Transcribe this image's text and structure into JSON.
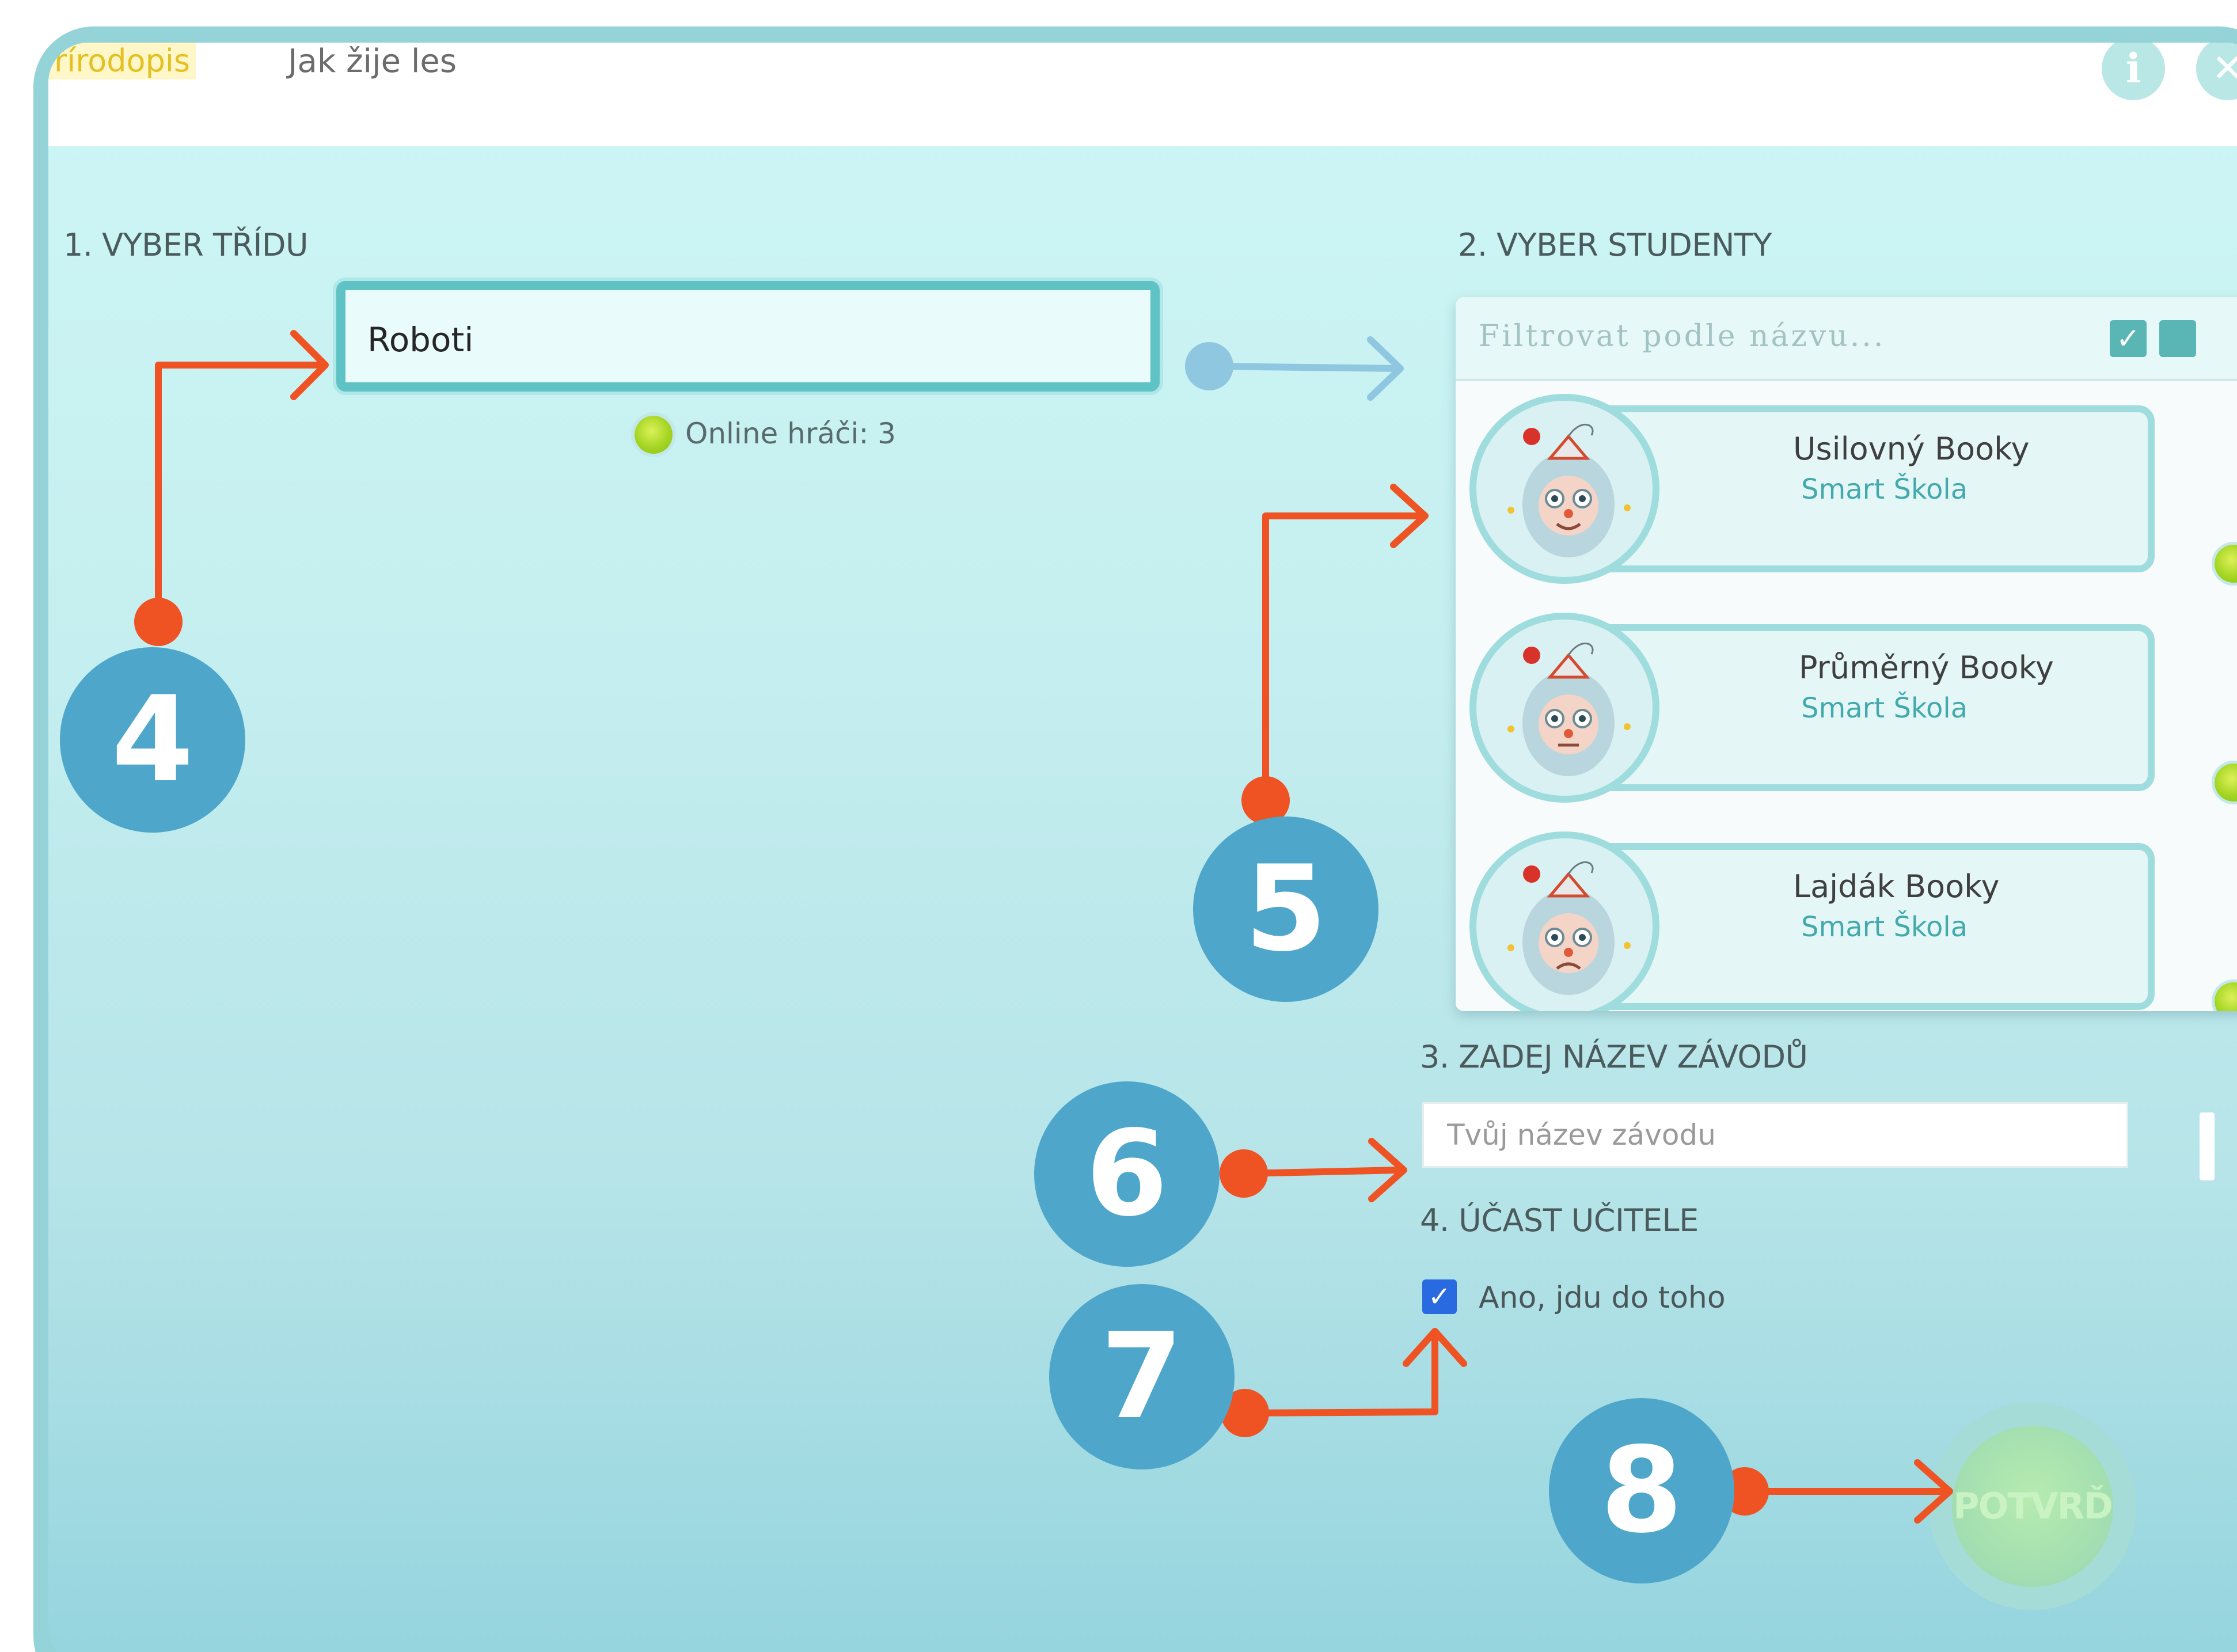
{
  "header": {
    "subject": "řírodopis",
    "title": "Jak žije les",
    "info_icon": "info-icon",
    "close_icon": "close-icon",
    "info_glyph": "i",
    "close_glyph": "✕"
  },
  "step1": {
    "label": "1. VYBER TŘÍDU",
    "selected_class": "Roboti",
    "online_text": "Online hráči: 3"
  },
  "step2": {
    "label": "2. VYBER STUDENTY",
    "filter_placeholder": "Filtrovat podle názvu...",
    "students": [
      {
        "name": "Usilovný Booky",
        "school": "Smart Škola",
        "status": "online"
      },
      {
        "name": "Průměrný Booky",
        "school": "Smart Škola",
        "status": "online"
      },
      {
        "name": "Lajdák Booky",
        "school": "Smart Škola",
        "status": "online"
      }
    ]
  },
  "step3": {
    "label": "3. ZADEJ NÁZEV ZÁVODŮ",
    "placeholder": "Tvůj název závodu"
  },
  "step4": {
    "label": "4. ÚČAST UČITELE",
    "checkbox_label": "Ano, jdu do toho",
    "checked": true
  },
  "confirm": {
    "label": "POTVRĎ"
  },
  "annotations": {
    "badges": [
      "4",
      "5",
      "6",
      "7",
      "8"
    ],
    "badge_color": "#4ea7cb",
    "arrow_color": "#ef5223"
  },
  "colors": {
    "accent_teal": "#5fc2c5",
    "online_green": "#a5d523",
    "school_text": "#43a9ad"
  }
}
